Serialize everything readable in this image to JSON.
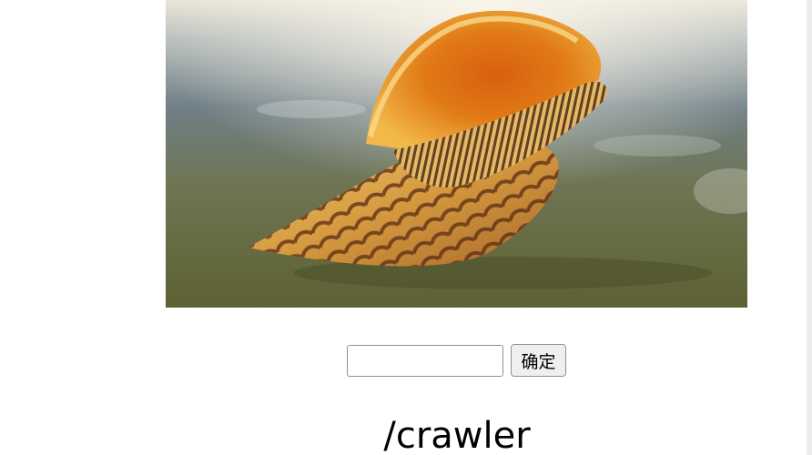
{
  "hero": {
    "image_name": "conch-shell-photo"
  },
  "form": {
    "input_value": "",
    "input_placeholder": "",
    "submit_label": "确定"
  },
  "path": {
    "text": "/crawler"
  },
  "colors": {
    "button_bg": "#efeff0",
    "border": "#8f8f9d",
    "text": "#000000"
  }
}
